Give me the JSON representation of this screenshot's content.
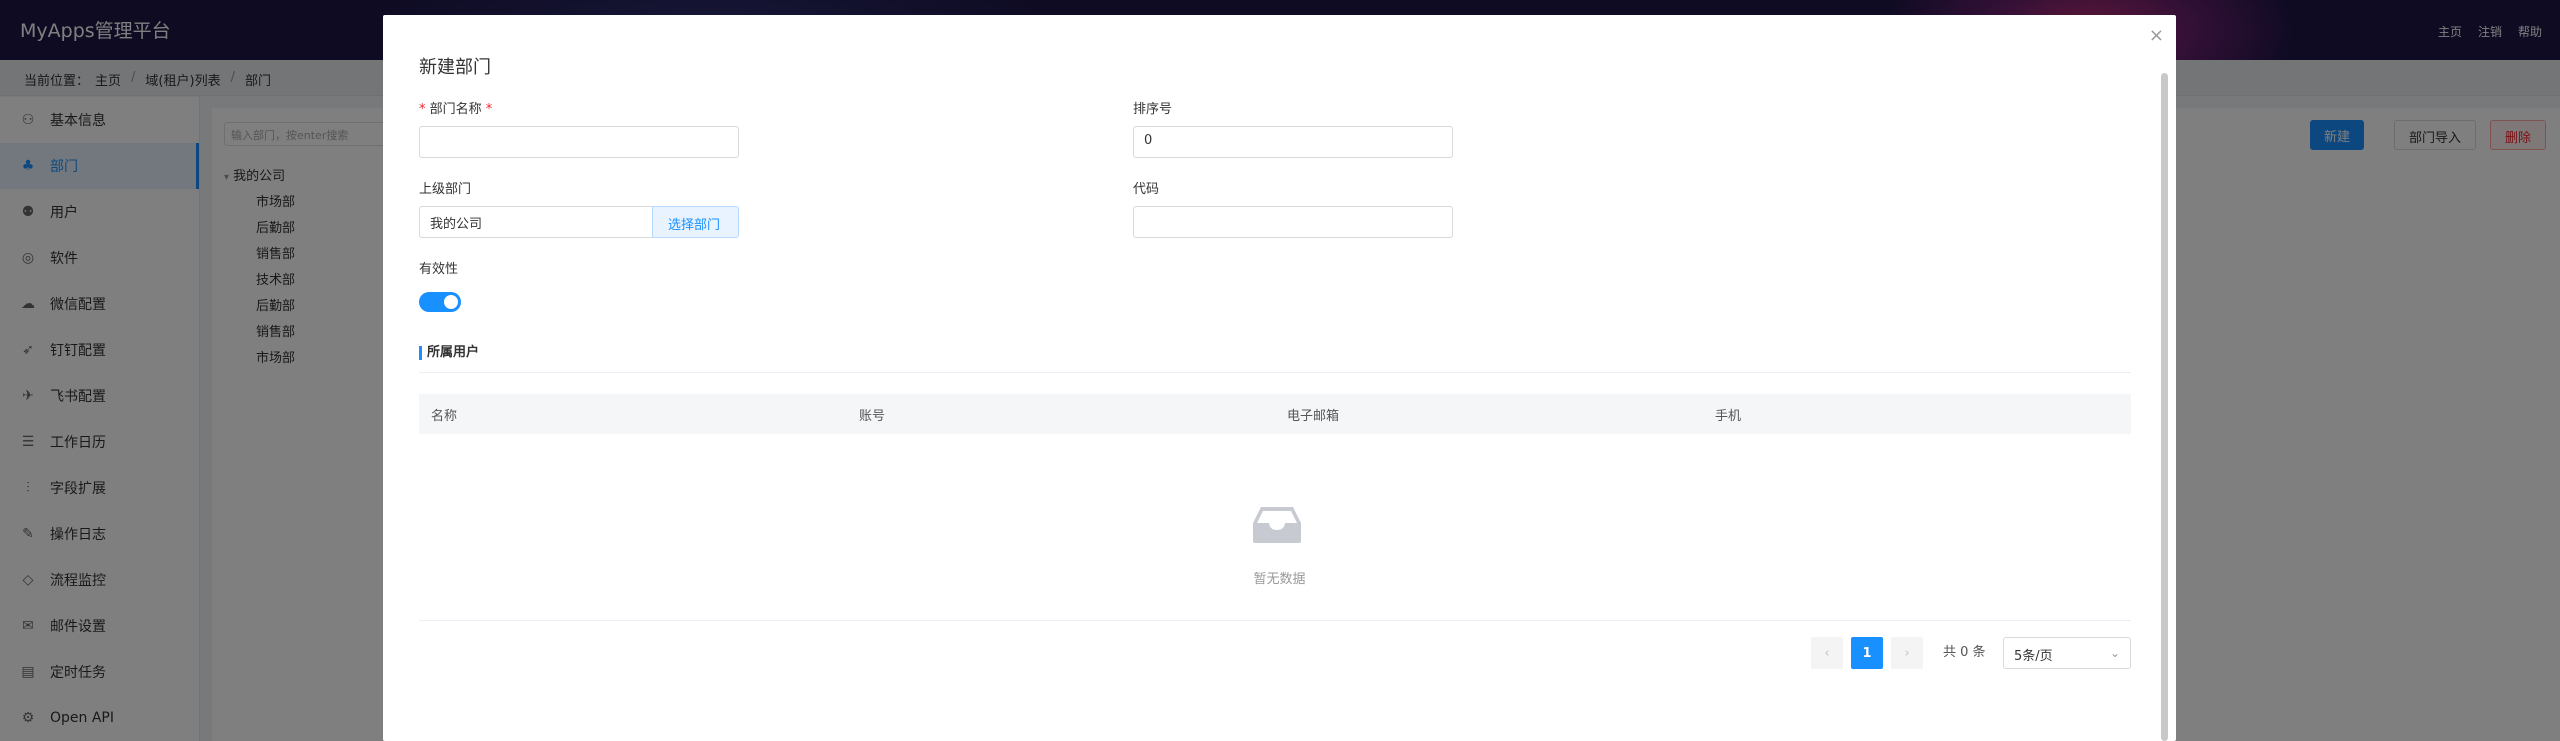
{
  "app": {
    "brand": "MyApps管理平台",
    "top_links": [
      "主页",
      "注销",
      "帮助"
    ]
  },
  "breadcrumb": {
    "prefix": "当前位置：",
    "items": [
      "主页",
      "域(租户)列表",
      "部门"
    ],
    "separator": "/"
  },
  "sidebar": {
    "items": [
      {
        "label": "基本信息",
        "icon": "user-icon"
      },
      {
        "label": "部门",
        "icon": "org-icon",
        "active": true
      },
      {
        "label": "用户",
        "icon": "users-icon"
      },
      {
        "label": "软件",
        "icon": "software-icon"
      },
      {
        "label": "微信配置",
        "icon": "wechat-icon"
      },
      {
        "label": "钉钉配置",
        "icon": "dingtalk-icon"
      },
      {
        "label": "飞书配置",
        "icon": "feishu-icon"
      },
      {
        "label": "工作日历",
        "icon": "calendar-icon"
      },
      {
        "label": "字段扩展",
        "icon": "sliders-icon"
      },
      {
        "label": "操作日志",
        "icon": "log-icon"
      },
      {
        "label": "流程监控",
        "icon": "monitor-icon"
      },
      {
        "label": "邮件设置",
        "icon": "mail-icon"
      },
      {
        "label": "定时任务",
        "icon": "task-icon"
      },
      {
        "label": "Open API",
        "icon": "api-icon"
      }
    ]
  },
  "tree": {
    "search_placeholder": "输入部门，按enter搜索",
    "root": "我的公司",
    "children": [
      "市场部",
      "后勤部",
      "销售部",
      "技术部",
      "后勤部",
      "销售部",
      "市场部"
    ]
  },
  "toolbar": {
    "new_label": "新建",
    "import_label": "部门导入",
    "delete_label": "删除"
  },
  "modal": {
    "title": "新建部门",
    "close_glyph": "×",
    "fields": {
      "name_label": "部门名称",
      "name_value": "",
      "order_label": "排序号",
      "order_value": "0",
      "parent_label": "上级部门",
      "parent_value": "我的公司",
      "select_parent_label": "选择部门",
      "code_label": "代码",
      "code_value": "",
      "valid_label": "有效性",
      "valid_on": true
    },
    "users_section": {
      "title": "所属用户",
      "columns": [
        "名称",
        "账号",
        "电子邮箱",
        "手机"
      ],
      "empty_text": "暂无数据"
    },
    "pagination": {
      "prev_glyph": "‹",
      "next_glyph": "›",
      "current_page": "1",
      "total_text": "共 0 条",
      "page_size": "5条/页"
    }
  },
  "colors": {
    "accent": "#1890ff",
    "topbar": "#1d1646",
    "danger": "#f5222d"
  }
}
